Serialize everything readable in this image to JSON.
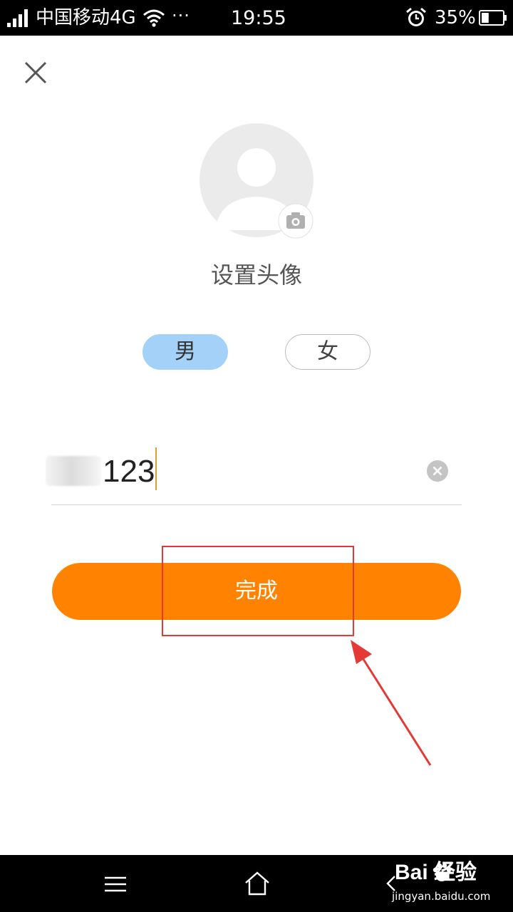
{
  "status_bar": {
    "carrier": "中国移动4G",
    "more": "···",
    "time": "19:55",
    "battery": "35%",
    "battery_level": 0.35,
    "icons": [
      "signal-icon",
      "wifi-icon",
      "alarm-icon",
      "battery-icon"
    ]
  },
  "header": {
    "close_icon": "close-icon"
  },
  "avatar": {
    "label": "设置头像",
    "placeholder_icon": "avatar-placeholder-icon",
    "camera_icon": "camera-icon"
  },
  "gender": {
    "male": "男",
    "female": "女",
    "selected": "male",
    "selected_color": "#a4d1f8"
  },
  "nickname": {
    "value": "123",
    "clear_icon": "clear-icon"
  },
  "done_button": {
    "label": "完成",
    "color": "#ff8300"
  },
  "annotation": {
    "color": "#e53935"
  },
  "nav_bar": {
    "icons": [
      "menu-icon",
      "home-icon",
      "back-icon"
    ]
  },
  "watermark": {
    "brand": "Bai 经验",
    "sub": "jingyan.baidu.com"
  }
}
